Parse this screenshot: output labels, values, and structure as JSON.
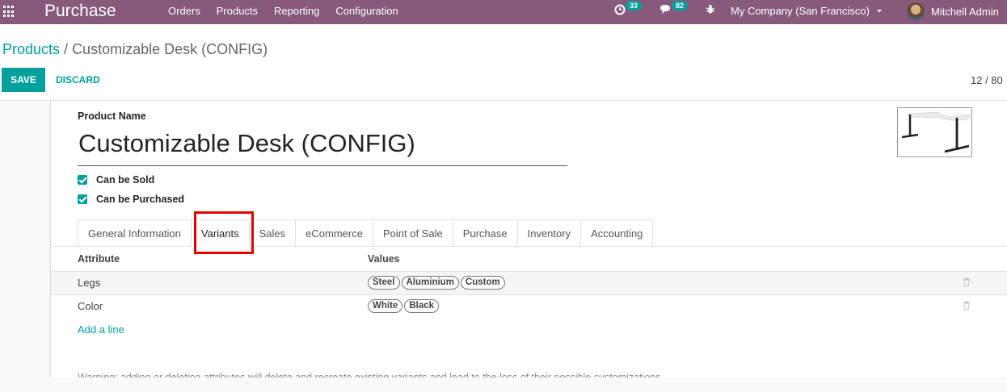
{
  "navbar": {
    "brand": "Purchase",
    "menu": [
      "Orders",
      "Products",
      "Reporting",
      "Configuration"
    ],
    "activity_count": "33",
    "messages_count": "82",
    "company": "My Company (San Francisco)",
    "user": "Mitchell Admin"
  },
  "breadcrumb": {
    "parent": "Products",
    "separator": "/",
    "current": "Customizable Desk (CONFIG)"
  },
  "buttons": {
    "save": "SAVE",
    "discard": "DISCARD"
  },
  "pager": {
    "text": "12 / 80"
  },
  "form": {
    "name_label": "Product Name",
    "name_value": "Customizable Desk (CONFIG)",
    "can_be_sold": "Can be Sold",
    "can_be_purchased": "Can be Purchased"
  },
  "tabs": [
    "General Information",
    "Variants",
    "Sales",
    "eCommerce",
    "Point of Sale",
    "Purchase",
    "Inventory",
    "Accounting"
  ],
  "active_tab": "Variants",
  "table": {
    "headers": {
      "attribute": "Attribute",
      "values": "Values"
    },
    "rows": [
      {
        "attribute": "Legs",
        "values": [
          "Steel",
          "Aluminium",
          "Custom"
        ]
      },
      {
        "attribute": "Color",
        "values": [
          "White",
          "Black"
        ]
      }
    ],
    "add_line": "Add a line"
  },
  "warning": "Warning: adding or deleting attributes will delete and recreate existing variants and lead to the loss of their possible customizations.",
  "colors": {
    "brand": "#875a7b",
    "accent": "#00a09d",
    "highlight": "#e60000"
  },
  "icons": [
    "apps-icon",
    "clock-icon",
    "chat-icon",
    "bug-icon",
    "caret-down-icon",
    "trash-icon"
  ]
}
